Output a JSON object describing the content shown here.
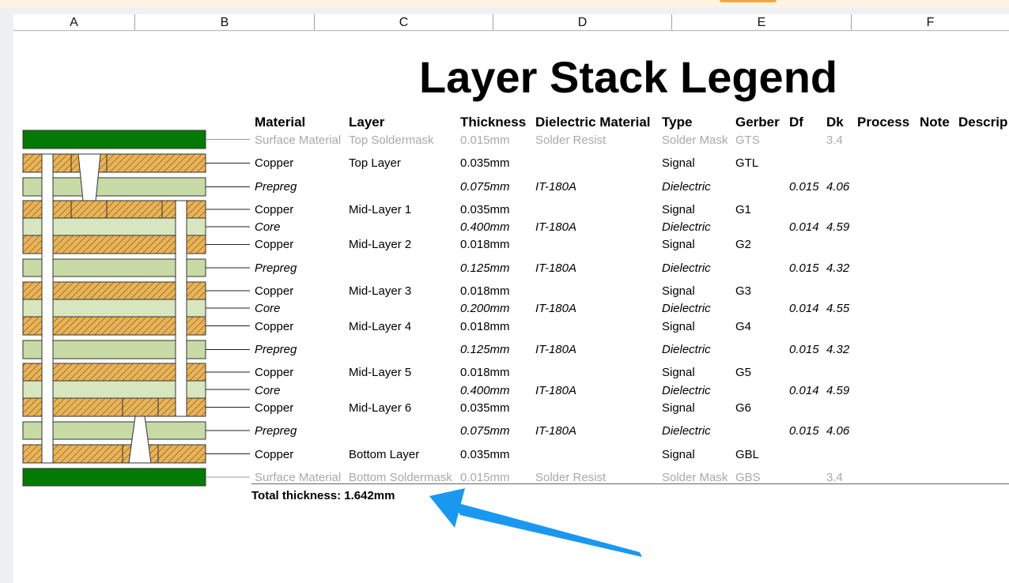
{
  "columns": [
    "A",
    "B",
    "C",
    "D",
    "E",
    "F"
  ],
  "title": "Layer Stack Legend",
  "headers": [
    "Material",
    "Layer",
    "Thickness",
    "Dielectric Material",
    "Type",
    "Gerber",
    "Df",
    "Dk",
    "Process",
    "Note",
    "Descrip"
  ],
  "rows": [
    {
      "material": "Surface Material",
      "layer": "Top Soldermask",
      "thickness": "0.015mm",
      "dielectric": "Solder Resist",
      "type": "Solder Mask",
      "gerber": "GTS",
      "df": "",
      "dk": "3.4",
      "style": "gray"
    },
    {
      "material": "Copper",
      "layer": "Top Layer",
      "thickness": "0.035mm",
      "dielectric": "",
      "type": "Signal",
      "gerber": "GTL",
      "df": "",
      "dk": "",
      "style": "normal"
    },
    {
      "material": "Prepreg",
      "layer": "",
      "thickness": "0.075mm",
      "dielectric": "IT-180A",
      "type": "Dielectric",
      "gerber": "",
      "df": "0.015",
      "dk": "4.06",
      "style": "italic"
    },
    {
      "material": "Copper",
      "layer": "Mid-Layer 1",
      "thickness": "0.035mm",
      "dielectric": "",
      "type": "Signal",
      "gerber": "G1",
      "df": "",
      "dk": "",
      "style": "normal"
    },
    {
      "material": "Core",
      "layer": "",
      "thickness": "0.400mm",
      "dielectric": "IT-180A",
      "type": "Dielectric",
      "gerber": "",
      "df": "0.014",
      "dk": "4.59",
      "style": "italic"
    },
    {
      "material": "Copper",
      "layer": "Mid-Layer 2",
      "thickness": "0.018mm",
      "dielectric": "",
      "type": "Signal",
      "gerber": "G2",
      "df": "",
      "dk": "",
      "style": "normal"
    },
    {
      "material": "Prepreg",
      "layer": "",
      "thickness": "0.125mm",
      "dielectric": "IT-180A",
      "type": "Dielectric",
      "gerber": "",
      "df": "0.015",
      "dk": "4.32",
      "style": "italic"
    },
    {
      "material": "Copper",
      "layer": "Mid-Layer 3",
      "thickness": "0.018mm",
      "dielectric": "",
      "type": "Signal",
      "gerber": "G3",
      "df": "",
      "dk": "",
      "style": "normal"
    },
    {
      "material": "Core",
      "layer": "",
      "thickness": "0.200mm",
      "dielectric": "IT-180A",
      "type": "Dielectric",
      "gerber": "",
      "df": "0.014",
      "dk": "4.55",
      "style": "italic"
    },
    {
      "material": "Copper",
      "layer": "Mid-Layer 4",
      "thickness": "0.018mm",
      "dielectric": "",
      "type": "Signal",
      "gerber": "G4",
      "df": "",
      "dk": "",
      "style": "normal"
    },
    {
      "material": "Prepreg",
      "layer": "",
      "thickness": "0.125mm",
      "dielectric": "IT-180A",
      "type": "Dielectric",
      "gerber": "",
      "df": "0.015",
      "dk": "4.32",
      "style": "italic"
    },
    {
      "material": "Copper",
      "layer": "Mid-Layer 5",
      "thickness": "0.018mm",
      "dielectric": "",
      "type": "Signal",
      "gerber": "G5",
      "df": "",
      "dk": "",
      "style": "normal"
    },
    {
      "material": "Core",
      "layer": "",
      "thickness": "0.400mm",
      "dielectric": "IT-180A",
      "type": "Dielectric",
      "gerber": "",
      "df": "0.014",
      "dk": "4.59",
      "style": "italic"
    },
    {
      "material": "Copper",
      "layer": "Mid-Layer 6",
      "thickness": "0.035mm",
      "dielectric": "",
      "type": "Signal",
      "gerber": "G6",
      "df": "",
      "dk": "",
      "style": "normal"
    },
    {
      "material": "Prepreg",
      "layer": "",
      "thickness": "0.075mm",
      "dielectric": "IT-180A",
      "type": "Dielectric",
      "gerber": "",
      "df": "0.015",
      "dk": "4.06",
      "style": "italic"
    },
    {
      "material": "Copper",
      "layer": "Bottom Layer",
      "thickness": "0.035mm",
      "dielectric": "",
      "type": "Signal",
      "gerber": "GBL",
      "df": "",
      "dk": "",
      "style": "normal"
    },
    {
      "material": "Surface Material",
      "layer": "Bottom Soldermask",
      "thickness": "0.015mm",
      "dielectric": "Solder Resist",
      "type": "Solder Mask",
      "gerber": "GBS",
      "df": "",
      "dk": "3.4",
      "style": "gray"
    }
  ],
  "total_thickness": "Total thickness: 1.642mm",
  "colors": {
    "soldermask": "#047a04",
    "copper": "#e9b35a",
    "dielectric": "#c8dba6",
    "core": "#d7e6bf",
    "arrow": "#1a98f0"
  }
}
